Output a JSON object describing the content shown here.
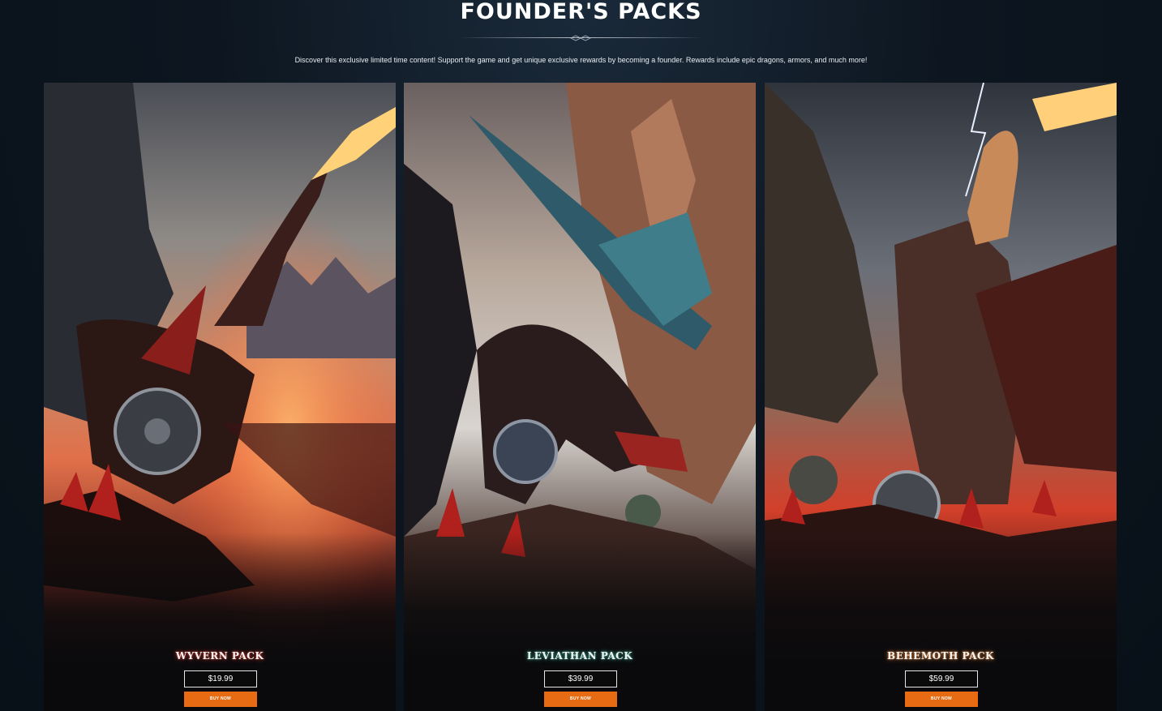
{
  "header": {
    "title": "FOUNDER'S PACKS",
    "subtitle": "Discover this exclusive limited time content! Support the game and get unique exclusive rewards by becoming a founder. Rewards include epic dragons, armors, and much more!"
  },
  "packs": [
    {
      "name": "WYVERN PACK",
      "price": "$19.99",
      "button": "BUY NOW",
      "glow": "#c0392b"
    },
    {
      "name": "LEVIATHAN PACK",
      "price": "$39.99",
      "button": "BUY NOW",
      "glow": "#3fa58a"
    },
    {
      "name": "BEHEMOTH PACK",
      "price": "$59.99",
      "button": "BUY NOW",
      "glow": "#d07a3a"
    }
  ],
  "colors": {
    "accent": "#e66b12",
    "background": "#0d1620"
  }
}
